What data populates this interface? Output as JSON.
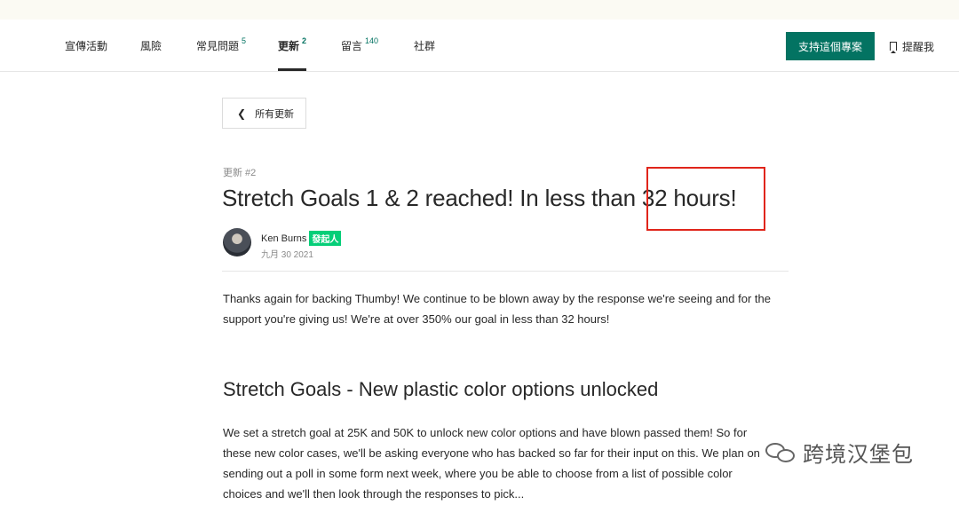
{
  "nav": {
    "tabs": [
      {
        "label": "宣傳活動",
        "count": ""
      },
      {
        "label": "風險",
        "count": ""
      },
      {
        "label": "常見問題",
        "count": "5"
      },
      {
        "label": "更新",
        "count": "2"
      },
      {
        "label": "留言",
        "count": "140"
      },
      {
        "label": "社群",
        "count": ""
      }
    ],
    "back_project_label": "支持這個專案",
    "remind_label": "提醒我",
    "remind_icon": "bookmark-icon"
  },
  "back": {
    "label": "所有更新",
    "icon": "chevron-left-icon"
  },
  "post": {
    "update_number": "更新 #2",
    "title": "Stretch Goals 1 & 2 reached! In less than 32 hours!",
    "author": "Ken Burns",
    "author_badge": "發起人",
    "date": "九月 30 2021",
    "paragraph1_line1": "Thanks again for backing Thumby!  We continue to be blown away by the response we're seeing and for the",
    "paragraph1_line2": "support you're giving us!  We're at over 350% our goal in less than 32 hours!",
    "heading": "Stretch Goals - New plastic color options unlocked",
    "paragraph2_line1": "We set a stretch goal at 25K and 50K to unlock new color options and have blown passed them!   So for",
    "paragraph2_line2": "these new color cases, we'll be asking everyone who has backed so far for their input on this.  We plan on",
    "paragraph2_line3": "sending out a poll in some form next week, where you be able to choose from a list of possible color",
    "paragraph2_line4": "choices and we'll then look through the responses to pick..."
  },
  "watermark": {
    "text": "跨境汉堡包",
    "icon": "wechat-icon"
  },
  "colors": {
    "accent": "#037362",
    "badge": "#05ce78",
    "annotation": "#e0251b"
  }
}
